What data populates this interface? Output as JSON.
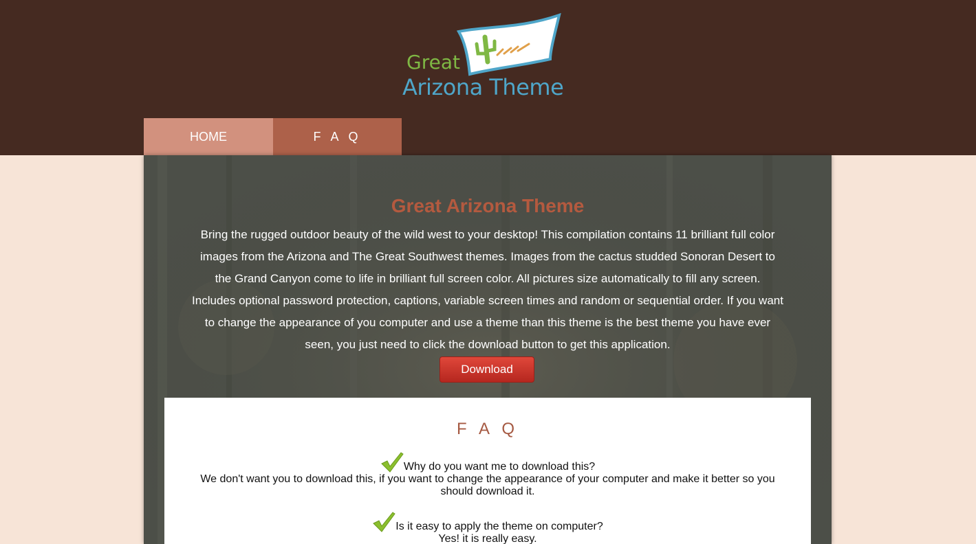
{
  "logo": {
    "line1": "Great",
    "line2": "Arizona Theme"
  },
  "nav": {
    "home": "HOME",
    "faq": "F A Q"
  },
  "hero": {
    "title": "Great Arizona Theme",
    "text": "Bring the rugged outdoor beauty of the wild west to your desktop! This compilation contains 11 brilliant full color images from the Arizona and The Great Southwest themes. Images from the cactus studded Sonoran Desert to the Grand Canyon come to life in brilliant full screen color. All pictures size automatically to fill any screen. Includes optional password protection, captions, variable screen times and random or sequential order. If you want to change the appearance of you computer and use a theme than this theme is the best theme you have ever seen, you just need to click the download button to get this application.",
    "download_label": "Download"
  },
  "faq": {
    "title": "F A Q",
    "items": [
      {
        "question": "Why do you want me to download this?",
        "answer": "We don't want you to download this, if you want to change the appearance of your computer and make it better so you should download it."
      },
      {
        "question": "Is it easy to apply the theme on computer?",
        "answer": "Yes! it is really easy."
      }
    ]
  },
  "colors": {
    "header_bg": "#452a21",
    "page_bg": "#f7e4d7",
    "nav_home": "#d2917e",
    "nav_faq": "#ad614a",
    "accent_title": "#b45a3f",
    "download_button": "#d23b30",
    "check_green": "#8bbf2e"
  },
  "icons": {
    "check": "checkmark-icon",
    "logo_cactus": "cactus-flag-icon"
  }
}
